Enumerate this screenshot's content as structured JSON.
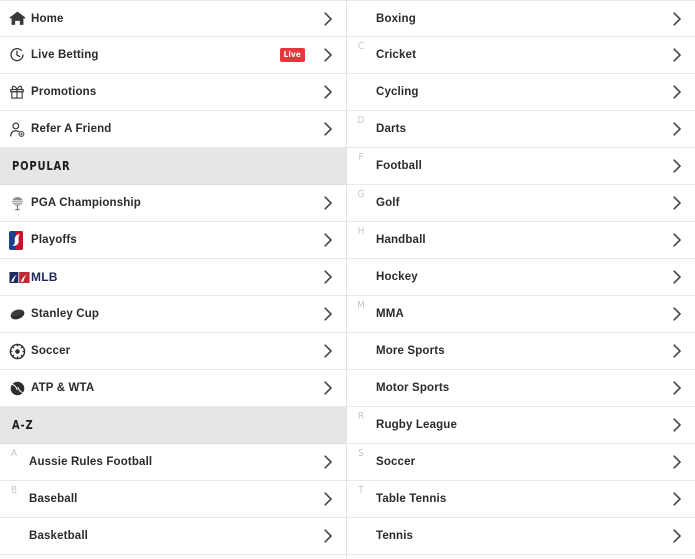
{
  "colors": {
    "live_badge_bg": "#e8373c",
    "section_header_bg": "#e6e6e6",
    "row_border": "#e8e8e8",
    "label_text": "#2b2b2b",
    "letter_text": "#c6c6c6",
    "mlb_blue": "#1d2b5c",
    "mlb_red": "#bf2a36"
  },
  "left_column": [
    {
      "kind": "row",
      "icon": "home-icon",
      "label": "Home",
      "letter": "",
      "badge": "",
      "chevron": "chevron-right-icon"
    },
    {
      "kind": "row",
      "icon": "live-clock-icon",
      "label": "Live Betting",
      "letter": "",
      "badge": "Live",
      "chevron": "chevron-right-icon"
    },
    {
      "kind": "row",
      "icon": "gift-icon",
      "label": "Promotions",
      "letter": "",
      "badge": "",
      "chevron": "chevron-right-icon"
    },
    {
      "kind": "row",
      "icon": "refer-friend-icon",
      "label": "Refer A Friend",
      "letter": "",
      "badge": "",
      "chevron": "chevron-right-icon"
    },
    {
      "kind": "header",
      "label": "POPULAR"
    },
    {
      "kind": "row",
      "icon": "golf-ball-tee-icon",
      "label": "PGA Championship",
      "letter": "",
      "badge": "",
      "chevron": "chevron-right-icon"
    },
    {
      "kind": "row",
      "icon": "nba-logo-icon",
      "label": "Playoffs",
      "letter": "",
      "badge": "",
      "chevron": "chevron-right-icon"
    },
    {
      "kind": "row",
      "icon": "mlb-logo-icon",
      "label": "MLB",
      "letter": "",
      "badge": "",
      "chevron": "chevron-right-icon"
    },
    {
      "kind": "row",
      "icon": "hockey-puck-icon",
      "label": "Stanley Cup",
      "letter": "",
      "badge": "",
      "chevron": "chevron-right-icon"
    },
    {
      "kind": "row",
      "icon": "soccer-ball-icon",
      "label": "Soccer",
      "letter": "",
      "badge": "",
      "chevron": "chevron-right-icon"
    },
    {
      "kind": "row",
      "icon": "tennis-ball-icon",
      "label": "ATP & WTA",
      "letter": "",
      "badge": "",
      "chevron": "chevron-right-icon"
    },
    {
      "kind": "header",
      "label": "A-Z"
    },
    {
      "kind": "row",
      "icon": "",
      "label": "Aussie Rules Football",
      "letter": "A",
      "badge": "",
      "chevron": "chevron-right-icon"
    },
    {
      "kind": "row",
      "icon": "",
      "label": "Baseball",
      "letter": "B",
      "badge": "",
      "chevron": "chevron-right-icon"
    },
    {
      "kind": "row",
      "icon": "",
      "label": "Basketball",
      "letter": "",
      "badge": "",
      "chevron": "chevron-right-icon"
    }
  ],
  "right_column": [
    {
      "kind": "row",
      "icon": "",
      "label": "Boxing",
      "letter": "",
      "badge": "",
      "chevron": "chevron-right-icon"
    },
    {
      "kind": "row",
      "icon": "",
      "label": "Cricket",
      "letter": "C",
      "badge": "",
      "chevron": "chevron-right-icon"
    },
    {
      "kind": "row",
      "icon": "",
      "label": "Cycling",
      "letter": "",
      "badge": "",
      "chevron": "chevron-right-icon"
    },
    {
      "kind": "row",
      "icon": "",
      "label": "Darts",
      "letter": "D",
      "badge": "",
      "chevron": "chevron-right-icon"
    },
    {
      "kind": "row",
      "icon": "",
      "label": "Football",
      "letter": "F",
      "badge": "",
      "chevron": "chevron-right-icon"
    },
    {
      "kind": "row",
      "icon": "",
      "label": "Golf",
      "letter": "G",
      "badge": "",
      "chevron": "chevron-right-icon"
    },
    {
      "kind": "row",
      "icon": "",
      "label": "Handball",
      "letter": "H",
      "badge": "",
      "chevron": "chevron-right-icon"
    },
    {
      "kind": "row",
      "icon": "",
      "label": "Hockey",
      "letter": "",
      "badge": "",
      "chevron": "chevron-right-icon"
    },
    {
      "kind": "row",
      "icon": "",
      "label": "MMA",
      "letter": "M",
      "badge": "",
      "chevron": "chevron-right-icon"
    },
    {
      "kind": "row",
      "icon": "",
      "label": "More Sports",
      "letter": "",
      "badge": "",
      "chevron": "chevron-right-icon"
    },
    {
      "kind": "row",
      "icon": "",
      "label": "Motor Sports",
      "letter": "",
      "badge": "",
      "chevron": "chevron-right-icon"
    },
    {
      "kind": "row",
      "icon": "",
      "label": "Rugby League",
      "letter": "R",
      "badge": "",
      "chevron": "chevron-right-icon"
    },
    {
      "kind": "row",
      "icon": "",
      "label": "Soccer",
      "letter": "S",
      "badge": "",
      "chevron": "chevron-right-icon"
    },
    {
      "kind": "row",
      "icon": "",
      "label": "Table Tennis",
      "letter": "T",
      "badge": "",
      "chevron": "chevron-right-icon"
    },
    {
      "kind": "row",
      "icon": "",
      "label": "Tennis",
      "letter": "",
      "badge": "",
      "chevron": "chevron-right-icon"
    }
  ]
}
